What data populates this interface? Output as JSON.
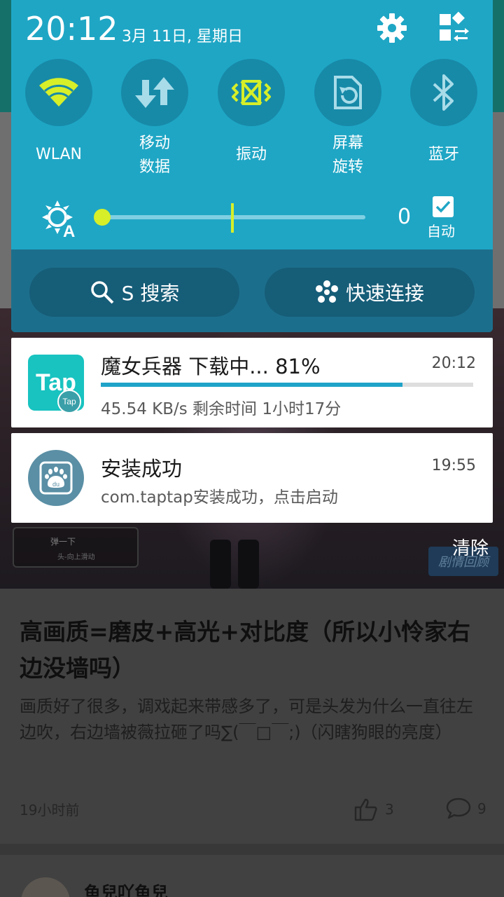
{
  "statusbar": {
    "clock": "20:12",
    "date": "3月 11日, 星期日"
  },
  "toggles": [
    {
      "name": "wlan",
      "label_lines": [
        "WLAN"
      ]
    },
    {
      "name": "mobile-data",
      "label_lines": [
        "移动",
        "数据"
      ]
    },
    {
      "name": "vibrate",
      "label_lines": [
        "振动"
      ]
    },
    {
      "name": "rotate",
      "label_lines": [
        "屏幕",
        "旋转"
      ]
    },
    {
      "name": "bluetooth",
      "label_lines": [
        "蓝牙"
      ]
    }
  ],
  "brightness": {
    "value": "0",
    "auto_label": "自动",
    "level": 0.0
  },
  "quick_buttons": {
    "search": "S 搜索",
    "connect": "快速连接"
  },
  "notifications": [
    {
      "app_icon_text": "Tap",
      "badge_text": "Tap",
      "title": "魔女兵器 下载中... 81%",
      "time": "20:12",
      "subtitle": "45.54 KB/s  剩余时间 1小时17分",
      "progress": 0.81
    },
    {
      "app_icon_text": "du",
      "title": "安装成功",
      "time": "19:55",
      "subtitle": "com.taptap安装成功，点击启动"
    }
  ],
  "clear_label": "清除",
  "background_post": {
    "hint_title": "弹一下",
    "hint_sub": "头-向上滑动",
    "replay_label": "剧情回顾",
    "title": "高画质=磨皮+高光+对比度（所以小怜家右边没墙吗）",
    "body": "画质好了很多，调戏起来带感多了，可是头发为什么一直往左边吹，右边墙被薇拉砸了吗∑(￣□￣;)（闪瞎狗眼的亮度）",
    "time": "19小时前",
    "likes": "3",
    "comments": "9",
    "next_user": "鱼兒吖鱼兒"
  },
  "colors": {
    "shade": "#1fa6c5",
    "accent_on": "#d6ef29",
    "toggle_off": "#a8dce9",
    "progress": "#1fa3c8"
  }
}
